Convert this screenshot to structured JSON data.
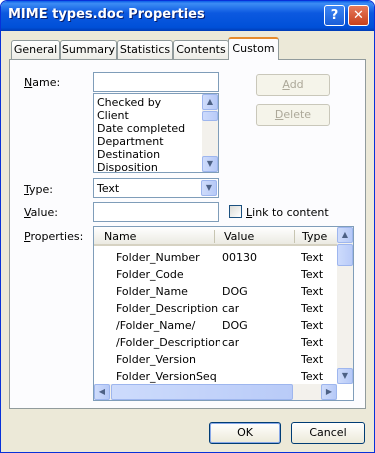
{
  "window": {
    "title": "MIME types.doc Properties",
    "help_glyph": "?",
    "close_glyph": "✕"
  },
  "tabs": [
    {
      "label": "General"
    },
    {
      "label": "Summary"
    },
    {
      "label": "Statistics"
    },
    {
      "label": "Contents"
    },
    {
      "label": "Custom",
      "active": true
    }
  ],
  "form": {
    "name_label_ul": "N",
    "name_label_rest": "ame:",
    "name_value": "",
    "name_options": [
      "Checked by",
      "Client",
      "Date completed",
      "Department",
      "Destination",
      "Disposition"
    ],
    "type_label_ul": "T",
    "type_label_rest": "ype:",
    "type_value": "Text",
    "value_label_ul": "V",
    "value_label_rest": "alue:",
    "value_value": "",
    "link_label_ul": "L",
    "link_label_rest": "ink to content",
    "link_checked": false,
    "properties_label_ul": "P",
    "properties_label_rest": "roperties:",
    "add_label": "Add",
    "add_ul": "A",
    "add_rest": "dd",
    "delete_ul": "D",
    "delete_rest": "elete"
  },
  "properties_table": {
    "columns": [
      "Name",
      "Value",
      "Type"
    ],
    "rows": [
      {
        "name": "Folder_Number",
        "value": "00130",
        "type": "Text"
      },
      {
        "name": "Folder_Code",
        "value": "",
        "type": "Text"
      },
      {
        "name": "Folder_Name",
        "value": "DOG",
        "type": "Text"
      },
      {
        "name": "Folder_Description",
        "value": "car",
        "type": "Text"
      },
      {
        "name": "/Folder_Name/",
        "value": "DOG",
        "type": "Text"
      },
      {
        "name": "/Folder_Description/",
        "value": "car",
        "type": "Text"
      },
      {
        "name": "Folder_Version",
        "value": "",
        "type": "Text"
      },
      {
        "name": "Folder_VersionSeq",
        "value": "",
        "type": "Text"
      }
    ]
  },
  "buttons": {
    "ok": "OK",
    "cancel": "Cancel"
  },
  "colors": {
    "titlebar": "#0054e3",
    "dialog_bg": "#ece9d8",
    "tab_active_accent": "#e68b2c",
    "input_border": "#7f9db9"
  },
  "icons": {
    "scroll_up": "▲",
    "scroll_down": "▼",
    "scroll_left": "◀",
    "scroll_right": "▶",
    "combo_arrow": "▼"
  }
}
